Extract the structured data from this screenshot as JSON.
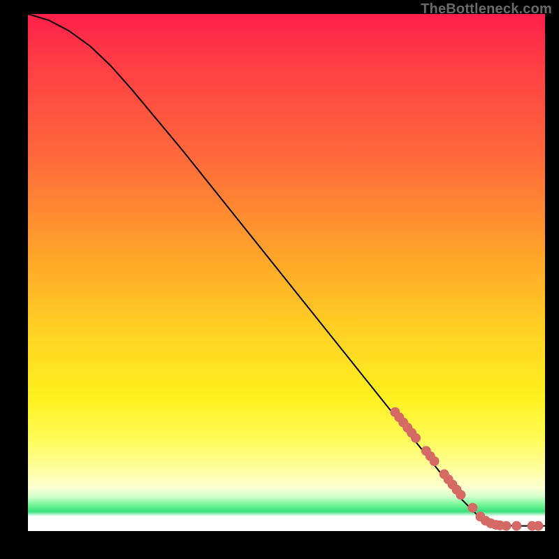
{
  "watermark": "TheBottleneck.com",
  "chart_data": {
    "type": "line",
    "title": "",
    "xlabel": "",
    "ylabel": "",
    "xlim": [
      0,
      100
    ],
    "ylim": [
      0,
      100
    ],
    "grid": false,
    "legend": false,
    "curve": [
      {
        "x": 0,
        "y": 100
      },
      {
        "x": 4,
        "y": 98.8
      },
      {
        "x": 8,
        "y": 96.7
      },
      {
        "x": 12,
        "y": 93.8
      },
      {
        "x": 16,
        "y": 90.0
      },
      {
        "x": 20,
        "y": 85.5
      },
      {
        "x": 30,
        "y": 73.5
      },
      {
        "x": 40,
        "y": 61.0
      },
      {
        "x": 50,
        "y": 48.5
      },
      {
        "x": 60,
        "y": 36.0
      },
      {
        "x": 70,
        "y": 23.5
      },
      {
        "x": 78,
        "y": 13.5
      },
      {
        "x": 84,
        "y": 6.0
      },
      {
        "x": 87,
        "y": 3.0
      },
      {
        "x": 89,
        "y": 1.8
      },
      {
        "x": 91,
        "y": 1.2
      },
      {
        "x": 94,
        "y": 1.0
      },
      {
        "x": 100,
        "y": 1.0
      }
    ],
    "points": [
      {
        "x": 71.0,
        "y": 23.0
      },
      {
        "x": 71.8,
        "y": 22.0
      },
      {
        "x": 72.6,
        "y": 21.0
      },
      {
        "x": 73.4,
        "y": 20.0
      },
      {
        "x": 74.2,
        "y": 19.0
      },
      {
        "x": 75.0,
        "y": 18.0
      },
      {
        "x": 77.0,
        "y": 15.5
      },
      {
        "x": 77.8,
        "y": 14.5
      },
      {
        "x": 78.6,
        "y": 13.5
      },
      {
        "x": 80.5,
        "y": 11.0
      },
      {
        "x": 81.3,
        "y": 10.0
      },
      {
        "x": 82.1,
        "y": 9.0
      },
      {
        "x": 82.9,
        "y": 8.0
      },
      {
        "x": 83.7,
        "y": 7.0
      },
      {
        "x": 86.0,
        "y": 4.5
      },
      {
        "x": 87.5,
        "y": 2.8
      },
      {
        "x": 88.5,
        "y": 2.0
      },
      {
        "x": 89.5,
        "y": 1.5
      },
      {
        "x": 90.5,
        "y": 1.2
      },
      {
        "x": 91.3,
        "y": 1.1
      },
      {
        "x": 92.5,
        "y": 1.0
      },
      {
        "x": 94.5,
        "y": 1.0
      },
      {
        "x": 97.5,
        "y": 1.0
      },
      {
        "x": 98.7,
        "y": 1.0
      }
    ],
    "point_color": "#d46a63",
    "curve_color": "#000000",
    "background_gradient": [
      "#ff1f4b",
      "#ffa829",
      "#fff01f",
      "#38e27b",
      "#ffffff"
    ]
  }
}
